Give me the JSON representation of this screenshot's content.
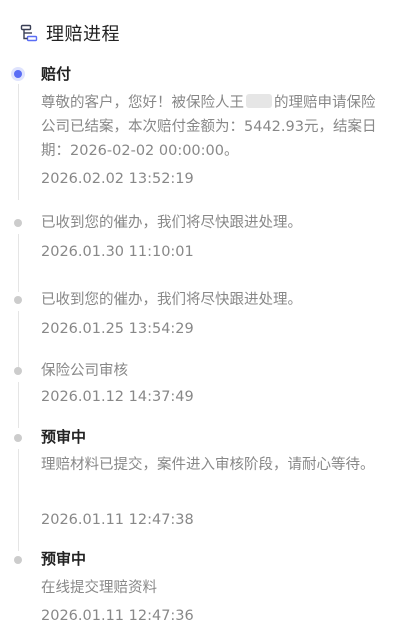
{
  "header": {
    "title": "理赔进程",
    "icon": "process-icon"
  },
  "timeline": [
    {
      "title": "赔付",
      "content_before_mask": "尊敬的客户，您好！被保险人王",
      "content_after_mask": "的理赔申请保险公司已结案，本次赔付金额为：5442.93元，结案日期：2026-02-02 00:00:00。",
      "time": "2026.02.02 13:52:19",
      "active": true
    },
    {
      "title": "",
      "content": "已收到您的催办，我们将尽快跟进处理。",
      "time": "2026.01.30 11:10:01"
    },
    {
      "title": "",
      "content": "已收到您的催办，我们将尽快跟进处理。",
      "time": "2026.01.25 13:54:29"
    },
    {
      "title": "",
      "content": "保险公司审核",
      "time": "2026.01.12 14:37:49"
    },
    {
      "title": "预审中",
      "content": "理赔材料已提交，案件进入审核阶段，请耐心等待。",
      "time": "2026.01.11 12:47:38"
    },
    {
      "title": "预审中",
      "content": "在线提交理赔资料",
      "time": "2026.01.11 12:47:36"
    }
  ],
  "colors": {
    "accent": "#5a6df5",
    "dot_inactive": "#cccccc",
    "text_primary": "#222222",
    "text_secondary": "#888888"
  }
}
